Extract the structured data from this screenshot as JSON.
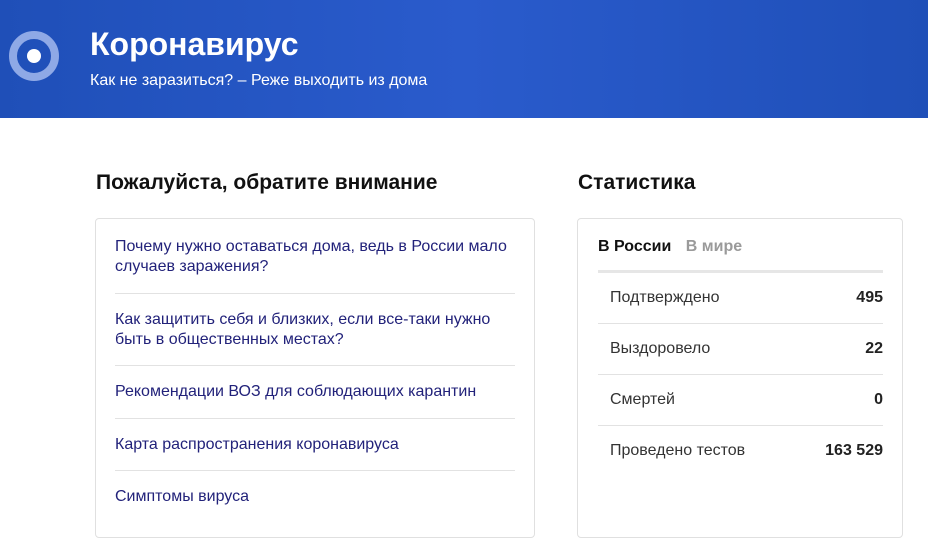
{
  "header": {
    "title": "Коронавирус",
    "subtitle": "Как не заразиться? – Реже выходить из дома",
    "logo_icon": "target-circle-icon",
    "colors": {
      "background": "#2152c4",
      "logo_outer": "#8fa9e6",
      "logo_inner": "#ffffff"
    }
  },
  "notice": {
    "heading": "Пожалуйста, обратите внимание",
    "items": [
      {
        "label": "Почему нужно оставаться дома, ведь в России мало случаев заражения?"
      },
      {
        "label": "Как защитить себя и близких, если все-таки нужно быть в общественных местах?"
      },
      {
        "label": "Рекомендации ВОЗ для соблюдающих карантин"
      },
      {
        "label": "Карта распространения коронавируса"
      },
      {
        "label": "Симптомы вируса"
      }
    ],
    "link_color": "#22227a"
  },
  "stats": {
    "heading": "Статистика",
    "tabs": [
      {
        "label": "В России",
        "active": true
      },
      {
        "label": "В мире",
        "active": false
      }
    ],
    "rows": [
      {
        "label": "Подтверждено",
        "value": "495"
      },
      {
        "label": "Выздоровело",
        "value": "22"
      },
      {
        "label": "Смертей",
        "value": "0"
      },
      {
        "label": "Проведено тестов",
        "value": "163 529"
      }
    ]
  }
}
